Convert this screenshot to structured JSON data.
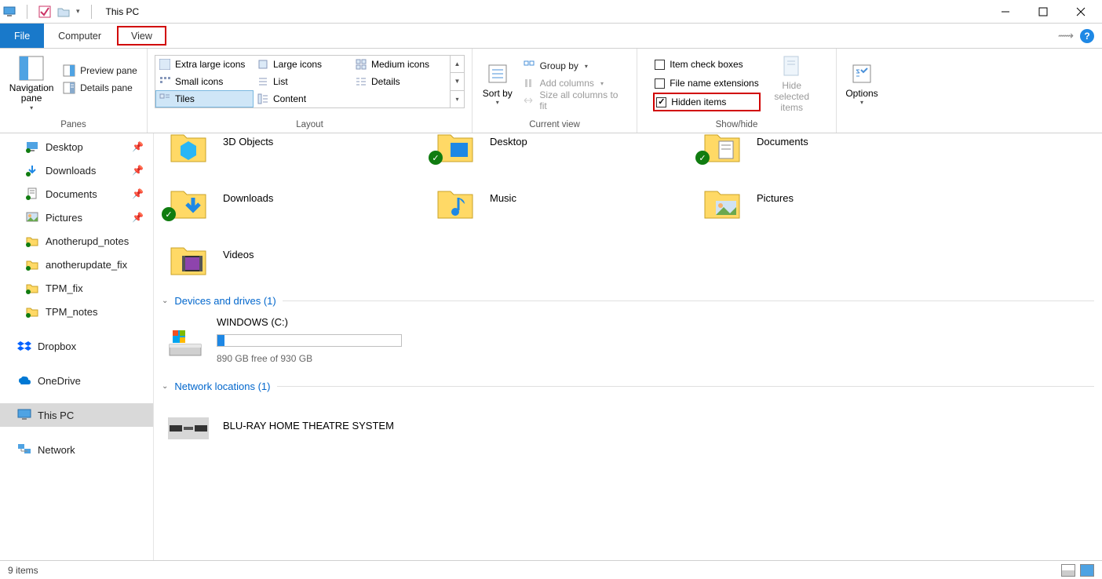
{
  "titlebar": {
    "title": "This PC"
  },
  "tabs": {
    "file": "File",
    "computer": "Computer",
    "view": "View"
  },
  "ribbon": {
    "panes": {
      "label": "Panes",
      "navigation": "Navigation pane",
      "preview": "Preview pane",
      "details": "Details pane"
    },
    "layout": {
      "label": "Layout",
      "extraLarge": "Extra large icons",
      "large": "Large icons",
      "medium": "Medium icons",
      "small": "Small icons",
      "list": "List",
      "details": "Details",
      "tiles": "Tiles",
      "content": "Content"
    },
    "currentView": {
      "label": "Current view",
      "sortBy": "Sort by",
      "groupBy": "Group by",
      "addColumns": "Add columns",
      "sizeAll": "Size all columns to fit"
    },
    "showHide": {
      "label": "Show/hide",
      "itemCheck": "Item check boxes",
      "fileExt": "File name extensions",
      "hidden": "Hidden items",
      "hideSelected": "Hide selected items",
      "options": "Options"
    }
  },
  "sidebar": {
    "items": [
      {
        "label": "Desktop",
        "icon": "desktop",
        "pinned": true
      },
      {
        "label": "Downloads",
        "icon": "downloads",
        "pinned": true
      },
      {
        "label": "Documents",
        "icon": "documents",
        "pinned": true
      },
      {
        "label": "Pictures",
        "icon": "pictures",
        "pinned": true
      },
      {
        "label": "Anotherupd_notes",
        "icon": "folder",
        "pinned": false
      },
      {
        "label": "anotherupdate_fix",
        "icon": "folder",
        "pinned": false
      },
      {
        "label": "TPM_fix",
        "icon": "folder",
        "pinned": false
      },
      {
        "label": "TPM_notes",
        "icon": "folder",
        "pinned": false
      }
    ],
    "dropbox": "Dropbox",
    "onedrive": "OneDrive",
    "thispc": "This PC",
    "network": "Network"
  },
  "content": {
    "foldersTop": [
      {
        "label": "3D Objects",
        "icon": "3d",
        "sync": false
      },
      {
        "label": "Desktop",
        "icon": "desktop-big",
        "sync": true
      },
      {
        "label": "Documents",
        "icon": "documents-big",
        "sync": true
      }
    ],
    "foldersRow2": [
      {
        "label": "Downloads",
        "icon": "downloads-big",
        "sync": true
      },
      {
        "label": "Music",
        "icon": "music-big",
        "sync": false
      },
      {
        "label": "Pictures",
        "icon": "pictures-big",
        "sync": false
      }
    ],
    "foldersRow3": [
      {
        "label": "Videos",
        "icon": "videos-big",
        "sync": false
      }
    ],
    "devicesHeader": "Devices and drives (1)",
    "drive": {
      "label": "WINDOWS (C:)",
      "freeText": "890 GB free of 930 GB",
      "fillPercent": 4
    },
    "networkHeader": "Network locations (1)",
    "network": {
      "label": "BLU-RAY HOME THEATRE SYSTEM"
    }
  },
  "statusbar": {
    "count": "9 items"
  }
}
